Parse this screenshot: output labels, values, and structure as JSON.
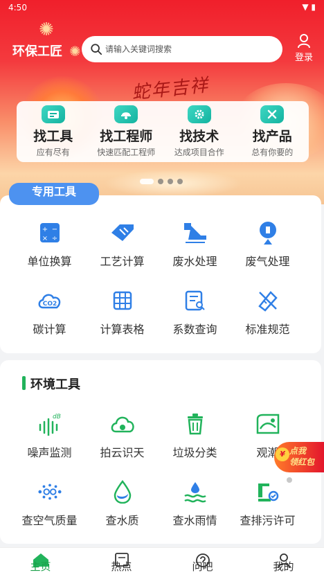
{
  "status": {
    "time": "4:50",
    "icons": "▼ ▮"
  },
  "header": {
    "app_title": "环保工匠",
    "search_placeholder": "请输入关键词搜索",
    "login_label": "登录"
  },
  "banner": {
    "slogan": "蛇年吉祥",
    "page_count": 4,
    "active_page": 0
  },
  "quick_entries": [
    {
      "title": "找工具",
      "subtitle": "应有尽有"
    },
    {
      "title": "找工程师",
      "subtitle": "快速匹配工程师"
    },
    {
      "title": "找技术",
      "subtitle": "达成项目合作"
    },
    {
      "title": "找产品",
      "subtitle": "总有你要的"
    }
  ],
  "special_tools": {
    "tag": "专用工具",
    "items": [
      {
        "label": "单位换算",
        "icon": "calculator-icon"
      },
      {
        "label": "工艺计算",
        "icon": "ruler-pencil-icon"
      },
      {
        "label": "废水处理",
        "icon": "wastewater-icon"
      },
      {
        "label": "废气处理",
        "icon": "exhaust-gas-icon"
      },
      {
        "label": "碳计算",
        "icon": "co2-cloud-icon"
      },
      {
        "label": "计算表格",
        "icon": "table-icon"
      },
      {
        "label": "系数查询",
        "icon": "list-search-icon"
      },
      {
        "label": "标准规范",
        "icon": "pencil-ruler-icon"
      }
    ]
  },
  "environment_tools": {
    "title": "环境工具",
    "items": [
      {
        "label": "噪声监测",
        "icon": "decibel-icon"
      },
      {
        "label": "拍云识天",
        "icon": "cloud-icon"
      },
      {
        "label": "垃圾分类",
        "icon": "trash-icon"
      },
      {
        "label": "观潮",
        "icon": "tide-icon"
      },
      {
        "label": "查空气质量",
        "icon": "air-quality-icon"
      },
      {
        "label": "查水质",
        "icon": "water-drop-icon"
      },
      {
        "label": "查水雨情",
        "icon": "rain-water-icon"
      },
      {
        "label": "查排污许可",
        "icon": "permit-icon"
      }
    ]
  },
  "float_badge": {
    "coin": "¥",
    "line1": "点我",
    "line2": "领红包"
  },
  "bottom_nav": [
    {
      "label": "主页",
      "icon": "home-icon",
      "active": true
    },
    {
      "label": "热点",
      "icon": "news-icon",
      "active": false
    },
    {
      "label": "问吧",
      "icon": "question-icon",
      "active": false
    },
    {
      "label": "我的",
      "icon": "user-icon",
      "active": false
    }
  ],
  "colors": {
    "brand_red": "#f01f2b",
    "accent_green": "#21b35b",
    "icon_blue": "#2f7fe6"
  }
}
